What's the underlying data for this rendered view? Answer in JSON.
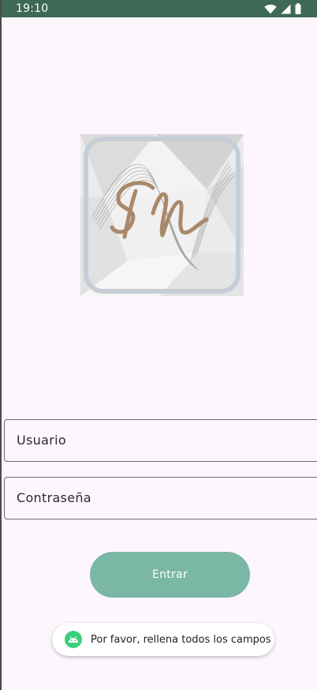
{
  "status_bar": {
    "time": "19:10",
    "icons": [
      "wifi-icon",
      "signal-icon",
      "battery-icon"
    ]
  },
  "logo": {
    "text": "SM"
  },
  "form": {
    "username_placeholder": "Usuario",
    "password_placeholder": "Contraseña",
    "submit_label": "Entrar"
  },
  "toast": {
    "message": "Por favor, rellena todos los campos",
    "icon": "android-icon"
  },
  "colors": {
    "status_bar": "#3e6a55",
    "background": "#fdf6fc",
    "button": "#7ab7a5",
    "toast_icon": "#3ccf7a"
  }
}
